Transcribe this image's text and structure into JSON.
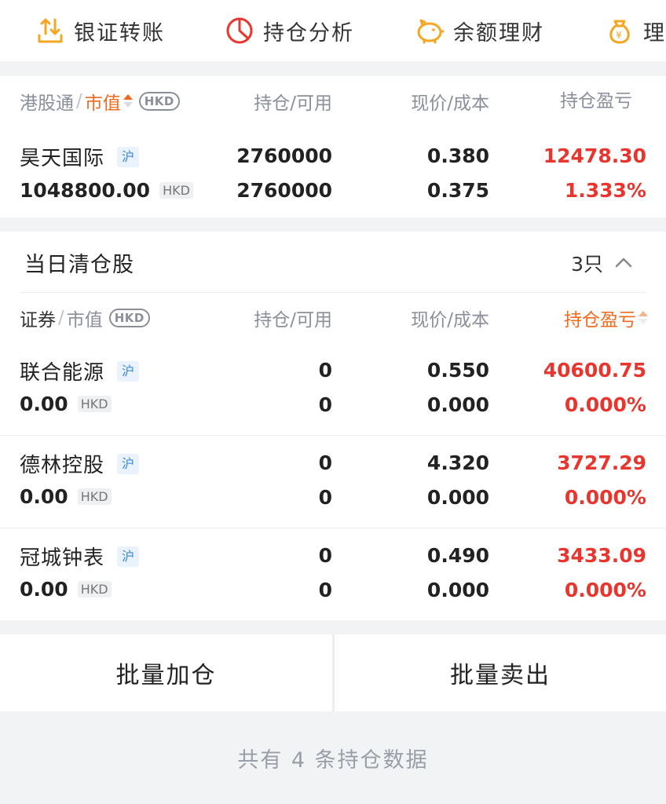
{
  "colors": {
    "accent": "#f06a1e",
    "loss": "#e8352e",
    "tag_text": "#3a86d6",
    "icon_orange": "#f5a623",
    "icon_red": "#e8352e"
  },
  "quick_actions": [
    {
      "label": "银证转账",
      "icon": "transfer-icon"
    },
    {
      "label": "持仓分析",
      "icon": "pie-chart-icon"
    },
    {
      "label": "余额理财",
      "icon": "piggy-bank-icon"
    },
    {
      "label": "理财",
      "icon": "money-bag-icon"
    }
  ],
  "holdings": {
    "header": {
      "market": "港股通",
      "sep": "/",
      "sort_by": "市值",
      "currency": "HKD",
      "position": "持仓/可用",
      "price": "现价/成本",
      "pnl": "持仓盈亏"
    },
    "rows": [
      {
        "name": "昊天国际",
        "tag": "沪",
        "market_value": "1048800.00",
        "currency": "HKD",
        "position": "2760000",
        "available": "2760000",
        "price": "0.380",
        "cost": "0.375",
        "pnl": "12478.30",
        "pnl_pct": "1.333%"
      }
    ]
  },
  "cleared": {
    "title": "当日清仓股",
    "count": "3只",
    "header": {
      "security": "证券",
      "sep": "/",
      "market_value": "市值",
      "currency": "HKD",
      "position": "持仓/可用",
      "price": "现价/成本",
      "pnl": "持仓盈亏"
    },
    "rows": [
      {
        "name": "联合能源",
        "tag": "沪",
        "market_value": "0.00",
        "currency": "HKD",
        "position": "0",
        "available": "0",
        "price": "0.550",
        "cost": "0.000",
        "pnl": "40600.75",
        "pnl_pct": "0.000%"
      },
      {
        "name": "德林控股",
        "tag": "沪",
        "market_value": "0.00",
        "currency": "HKD",
        "position": "0",
        "available": "0",
        "price": "4.320",
        "cost": "0.000",
        "pnl": "3727.29",
        "pnl_pct": "0.000%"
      },
      {
        "name": "冠城钟表",
        "tag": "沪",
        "market_value": "0.00",
        "currency": "HKD",
        "position": "0",
        "available": "0",
        "price": "0.490",
        "cost": "0.000",
        "pnl": "3433.09",
        "pnl_pct": "0.000%"
      }
    ]
  },
  "actions": {
    "add": "批量加仓",
    "sell": "批量卖出"
  },
  "footer": "共有 4 条持仓数据"
}
